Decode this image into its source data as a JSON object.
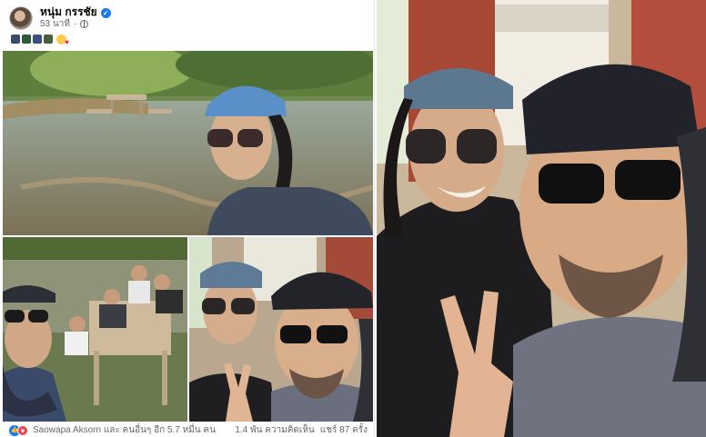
{
  "post": {
    "author": "หนุ่ม กรรชัย",
    "time": "53 นาที",
    "verified_icon": "verified-badge-icon",
    "privacy_icon": "globe-icon",
    "caption_emojis": [
      "sunglasses-face",
      "sunglasses-face",
      "sunglasses-face",
      "sunglasses-face",
      "smiling-face-with-hearts"
    ]
  },
  "footer": {
    "reactions": [
      "like",
      "love"
    ],
    "reaction_text": "Saowapa Aksorn และ คนอื่นๆ อีก 5.7 หมื่น คน",
    "comments": "1.4 พัน ความคิดเห็น",
    "shares": "แชร์ 87 ครั้ง"
  },
  "colors": {
    "brand_blue": "#1877f2",
    "love_red": "#f33e58",
    "secondary_text": "#65676b"
  },
  "photos": {
    "main": "river-picnic-selfie",
    "small_1": "group-at-picnic-table",
    "small_2": "two-men-selfie",
    "right": "two-men-selfie-closeup"
  }
}
